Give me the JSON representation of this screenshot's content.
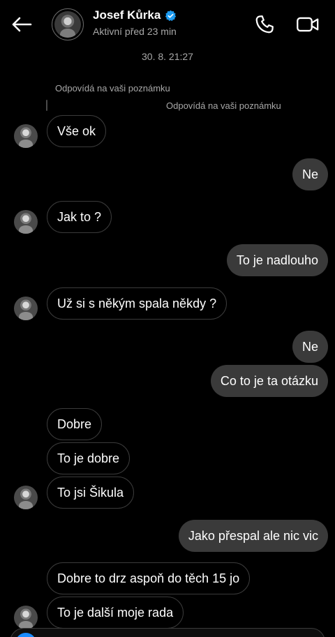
{
  "header": {
    "contact_name": "Josef Kůrka",
    "status": "Aktivní před 23 min",
    "icons": {
      "back": "arrow-left-icon",
      "verified": "verified-badge-icon",
      "call": "phone-icon",
      "video": "video-camera-icon"
    },
    "colors": {
      "verified": "#1d9bf0"
    }
  },
  "conversation": {
    "timestamp": "30. 8. 21:27",
    "reply_notes": [
      "Odpovídá na vaši poznámku",
      "Odpovídá na vaši poznámku"
    ],
    "messages": [
      {
        "direction": "in",
        "text": "Vše ok",
        "avatar": true
      },
      {
        "direction": "out",
        "text": "Ne"
      },
      {
        "direction": "in",
        "text": "Jak to ?",
        "avatar": true
      },
      {
        "direction": "out",
        "text": "To je nadlouho"
      },
      {
        "direction": "in",
        "text": "Už si s někým spala někdy ?",
        "avatar": true
      },
      {
        "direction": "out",
        "text": "Ne"
      },
      {
        "direction": "out",
        "text": "Co to je ta otázku"
      },
      {
        "direction": "in",
        "text": "Dobre",
        "avatar": false
      },
      {
        "direction": "in",
        "text": "To je dobre",
        "avatar": false
      },
      {
        "direction": "in",
        "text": "To jsi Šikula",
        "avatar": true
      },
      {
        "direction": "out",
        "text": "Jako přespal ale nic vic"
      },
      {
        "direction": "in",
        "text": "Dobre to drz aspoň do těch 15 jo",
        "avatar": false
      },
      {
        "direction": "in",
        "text": "To je další moje rada",
        "avatar": true
      }
    ]
  }
}
